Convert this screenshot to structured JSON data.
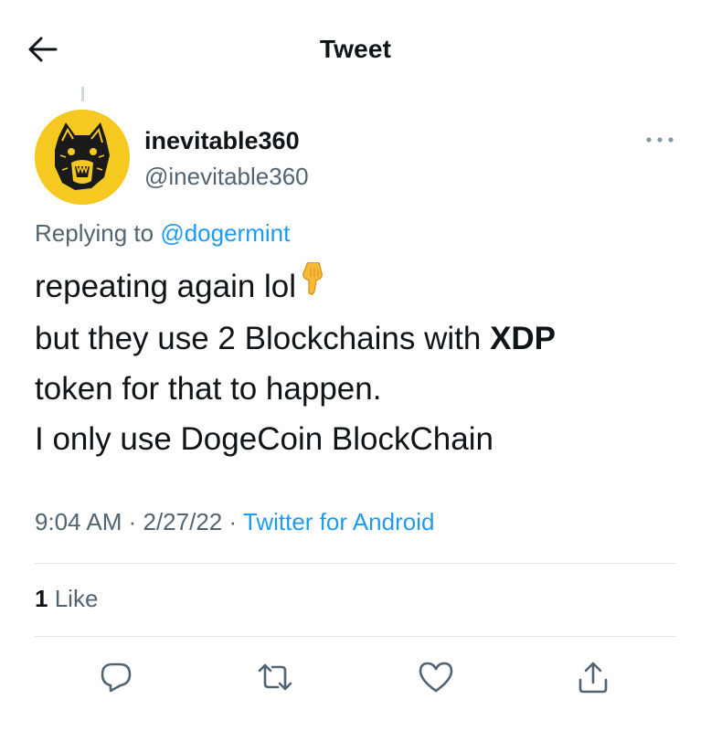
{
  "header": {
    "title": "Tweet"
  },
  "author": {
    "display_name": "inevitable360",
    "handle": "@inevitable360"
  },
  "reply": {
    "prefix": "Replying to",
    "mention": "@dogermint"
  },
  "tweet": {
    "line1": "repeating again lol",
    "line2_pre": "but they use 2 Blockchains with",
    "line2_bold": "XDP",
    "line3": "token for that to happen.",
    "line4": "I only use DogeCoin BlockChain"
  },
  "meta": {
    "timestamp": "9:04 AM · 2/27/22 · ",
    "source": "Twitter for Android"
  },
  "stats": {
    "likes_count": "1",
    "likes_label": "Like"
  },
  "icons": {
    "back": "back-arrow-icon",
    "more": "more-dots-icon",
    "emoji": "backhand-index-pointing-down-icon",
    "reply": "reply-icon",
    "retweet": "retweet-icon",
    "like": "heart-icon",
    "share": "share-icon"
  },
  "colors": {
    "accent": "#1d9bf0",
    "text": "#0f1419",
    "secondary": "#536471",
    "avatar_bg": "#f5c91f"
  }
}
